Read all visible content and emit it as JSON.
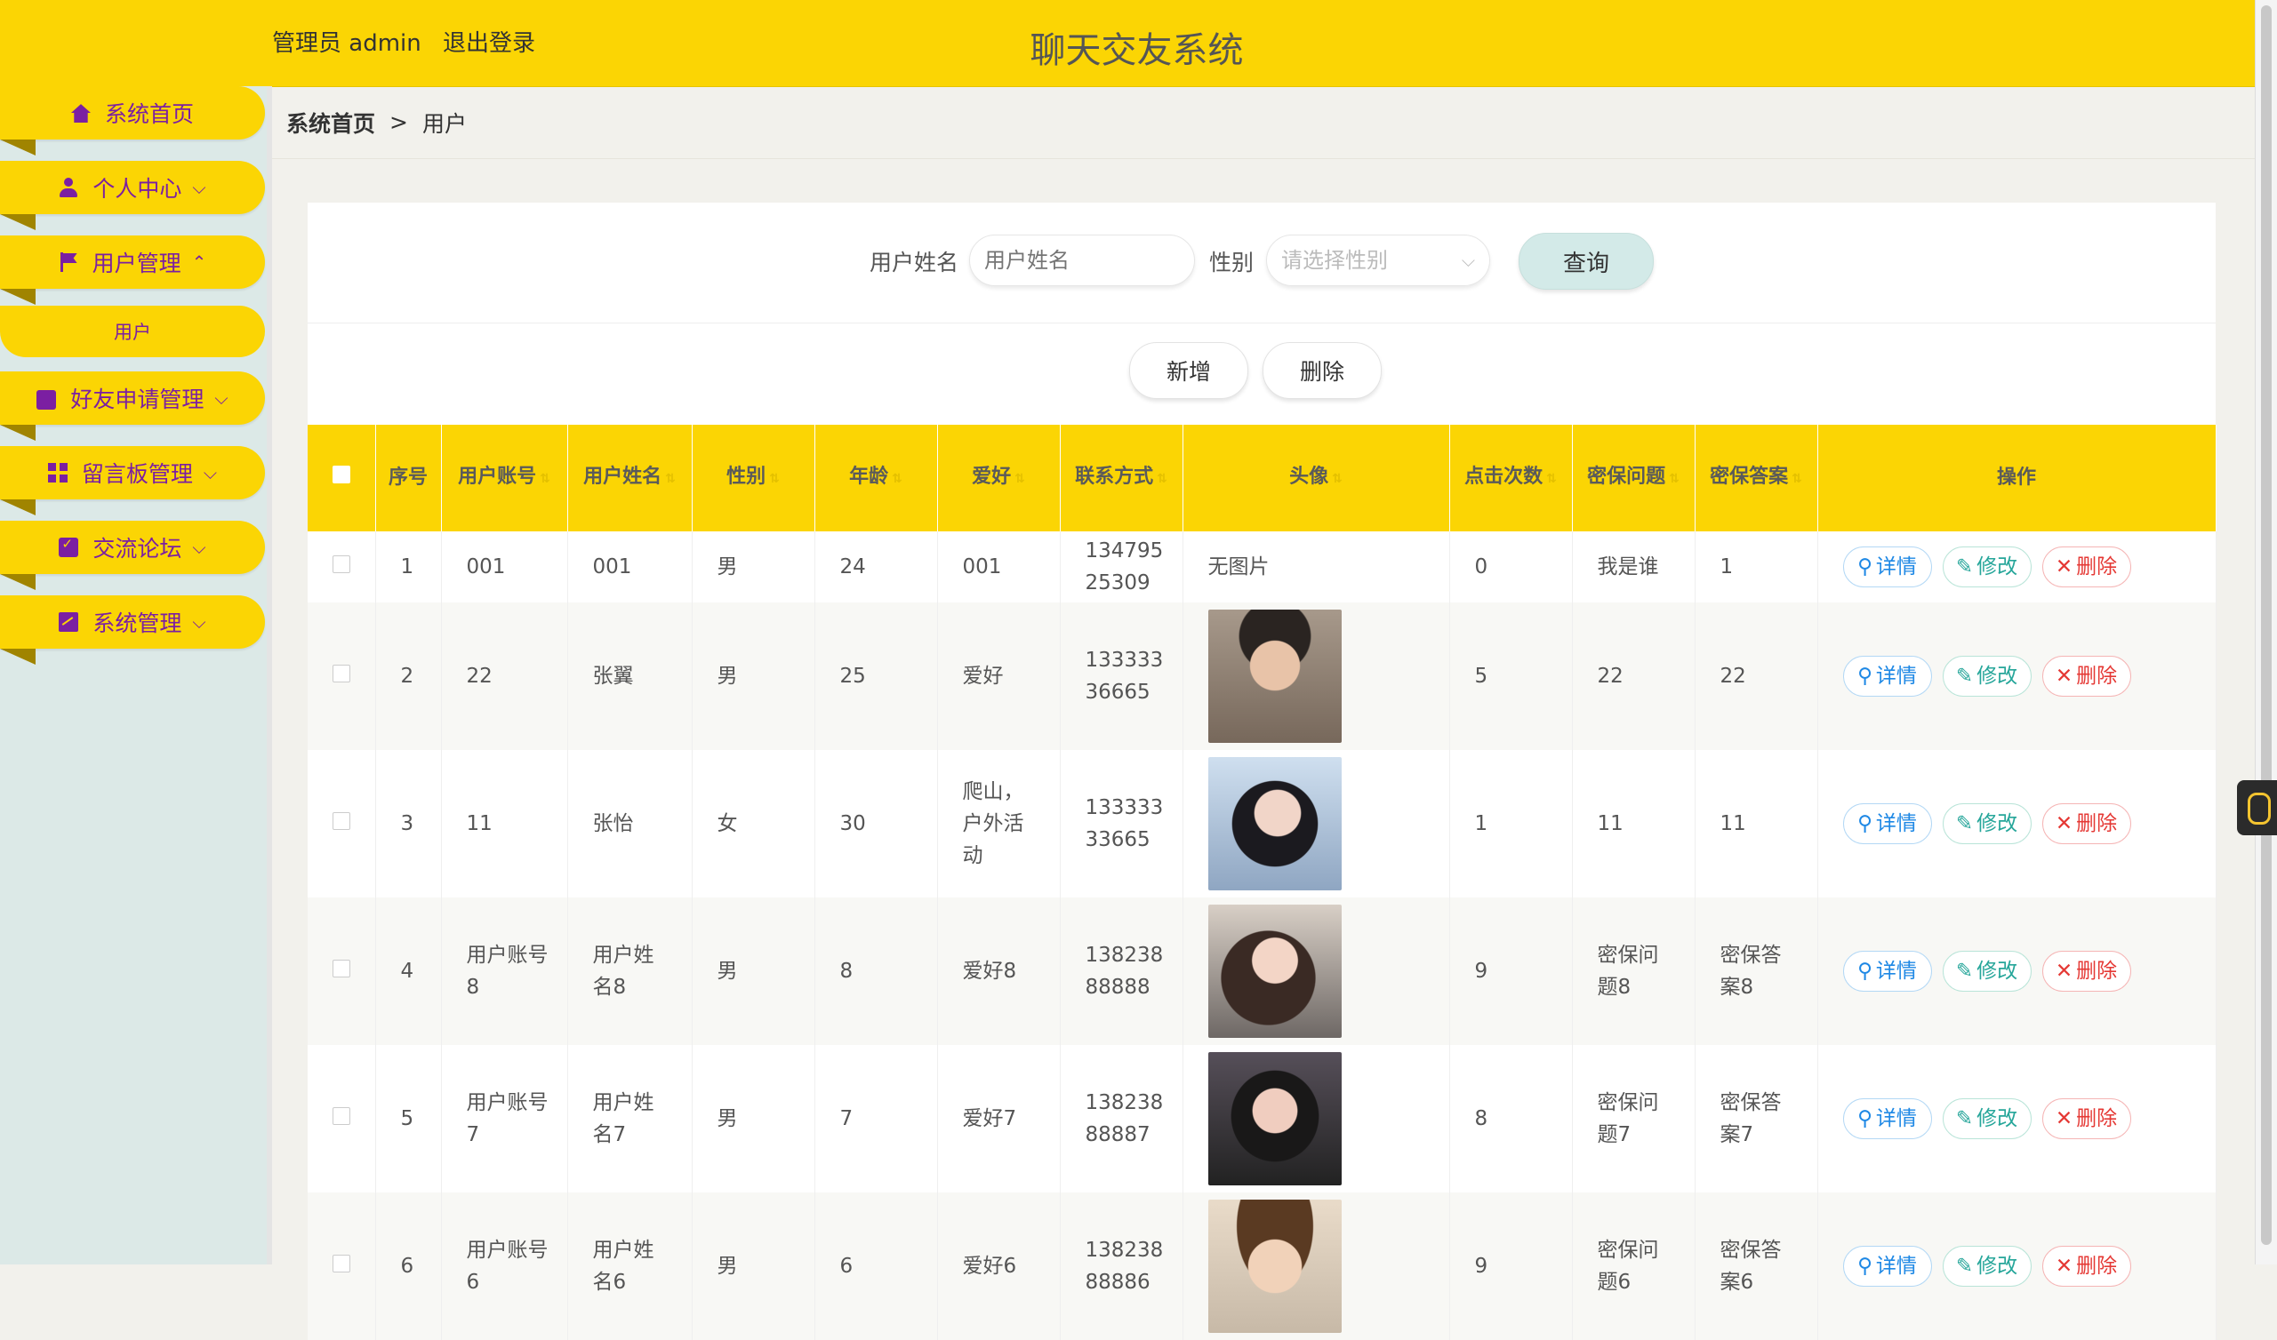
{
  "header": {
    "user_role": "管理员 admin",
    "logout": "退出登录",
    "title": "聊天交友系统"
  },
  "sidebar": {
    "items": [
      {
        "label": "系统首页",
        "icon": "home-icon",
        "chevron": ""
      },
      {
        "label": "个人中心",
        "icon": "user-icon",
        "chevron": "⌵"
      },
      {
        "label": "用户管理",
        "icon": "flag-icon",
        "chevron": "⌃"
      },
      {
        "label": "好友申请管理",
        "icon": "wallet-icon",
        "chevron": "⌵"
      },
      {
        "label": "留言板管理",
        "icon": "grid-icon",
        "chevron": "⌵"
      },
      {
        "label": "交流论坛",
        "icon": "clipboard-check-icon",
        "chevron": "⌵"
      },
      {
        "label": "系统管理",
        "icon": "chart-icon",
        "chevron": "⌵"
      }
    ],
    "sub_item": "用户"
  },
  "breadcrumb": {
    "home": "系统首页",
    "sep": ">",
    "current": "用户"
  },
  "search": {
    "name_label": "用户姓名",
    "name_placeholder": "用户姓名",
    "gender_label": "性别",
    "gender_placeholder": "请选择性别",
    "query_button": "查询"
  },
  "actions": {
    "add": "新增",
    "delete": "删除"
  },
  "table": {
    "headers": [
      "序号",
      "用户账号",
      "用户姓名",
      "性别",
      "年龄",
      "爱好",
      "联系方式",
      "头像",
      "点击次数",
      "密保问题",
      "密保答案",
      "操作"
    ],
    "rows": [
      {
        "no": "1",
        "account": "001",
        "name": "001",
        "gender": "男",
        "age": "24",
        "hobby": "001",
        "phone": "13479525309",
        "avatar": "无图片",
        "clicks": "0",
        "question": "我是谁",
        "answer": "1"
      },
      {
        "no": "2",
        "account": "22",
        "name": "张翼",
        "gender": "男",
        "age": "25",
        "hobby": "爱好",
        "phone": "13333336665",
        "avatar": "",
        "clicks": "5",
        "question": "22",
        "answer": "22"
      },
      {
        "no": "3",
        "account": "11",
        "name": "张怡",
        "gender": "女",
        "age": "30",
        "hobby": "爬山，户外活动",
        "phone": "13333333665",
        "avatar": "",
        "clicks": "1",
        "question": "11",
        "answer": "11"
      },
      {
        "no": "4",
        "account": "用户账号8",
        "name": "用户姓名8",
        "gender": "男",
        "age": "8",
        "hobby": "爱好8",
        "phone": "13823888888",
        "avatar": "",
        "clicks": "9",
        "question": "密保问题8",
        "answer": "密保答案8"
      },
      {
        "no": "5",
        "account": "用户账号7",
        "name": "用户姓名7",
        "gender": "男",
        "age": "7",
        "hobby": "爱好7",
        "phone": "13823888887",
        "avatar": "",
        "clicks": "8",
        "question": "密保问题7",
        "answer": "密保答案7"
      },
      {
        "no": "6",
        "account": "用户账号6",
        "name": "用户姓名6",
        "gender": "男",
        "age": "6",
        "hobby": "爱好6",
        "phone": "13823888886",
        "avatar": "",
        "clicks": "9",
        "question": "密保问题6",
        "answer": "密保答案6"
      }
    ],
    "ops": {
      "detail": "详情",
      "edit": "修改",
      "delete": "删除"
    }
  },
  "colors": {
    "accent": "#fbd504",
    "nav_text": "#7b1fa2",
    "sidebar_bg": "#dce9e7",
    "query_bg": "#d3eae8"
  }
}
